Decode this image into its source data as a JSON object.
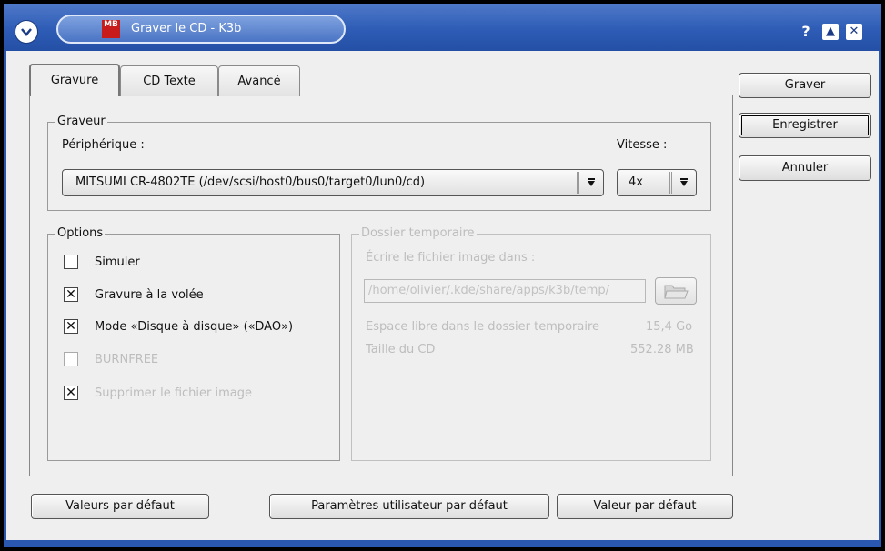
{
  "window": {
    "title": "Graver le CD - K3b",
    "app_icon_text": "MB",
    "help_glyph": "?",
    "shade_glyph": "▲",
    "close_glyph": "✕"
  },
  "tabs": [
    {
      "label": "Gravure"
    },
    {
      "label": "CD Texte"
    },
    {
      "label": "Avancé"
    }
  ],
  "graveur": {
    "title": "Graveur",
    "device_label": "Périphérique :",
    "device_value": "MITSUMI CR-4802TE (/dev/scsi/host0/bus0/target0/lun0/cd)",
    "speed_label": "Vitesse :",
    "speed_value": "4x"
  },
  "options": {
    "title": "Options",
    "items": [
      {
        "label": "Simuler",
        "checked": false,
        "enabled": true
      },
      {
        "label": "Gravure à la volée",
        "checked": true,
        "enabled": true
      },
      {
        "label": "Mode «Disque à disque» («DAO»)",
        "checked": true,
        "enabled": true
      },
      {
        "label": "BURNFREE",
        "checked": false,
        "enabled": false
      },
      {
        "label": "Supprimer le fichier image",
        "checked": true,
        "enabled": false
      }
    ]
  },
  "temp": {
    "title": "Dossier temporaire",
    "write_label": "Écrire le fichier image dans :",
    "path": "/home/olivier/.kde/share/apps/k3b/temp/",
    "free_label": "Espace libre dans le dossier temporaire",
    "free_value": "15,4 Go",
    "size_label": "Taille du CD",
    "size_value": "552.28 MB"
  },
  "side_buttons": {
    "burn": "Graver",
    "save": "Enregistrer",
    "cancel": "Annuler"
  },
  "bottom_buttons": {
    "defaults": "Valeurs par défaut",
    "user_defaults": "Paramètres utilisateur par défaut",
    "default_value": "Valeur par défaut"
  },
  "colors": {
    "titlebar": "#2e5cb6",
    "background": "#efefef",
    "disabled_text": "#bdbdbd"
  },
  "icons": {
    "window_menu": "chevron-down-icon",
    "help": "help-icon",
    "shade": "shade-icon",
    "close": "close-icon",
    "folder": "folder-open-icon",
    "dropdown": "dropdown-arrow-icon"
  }
}
